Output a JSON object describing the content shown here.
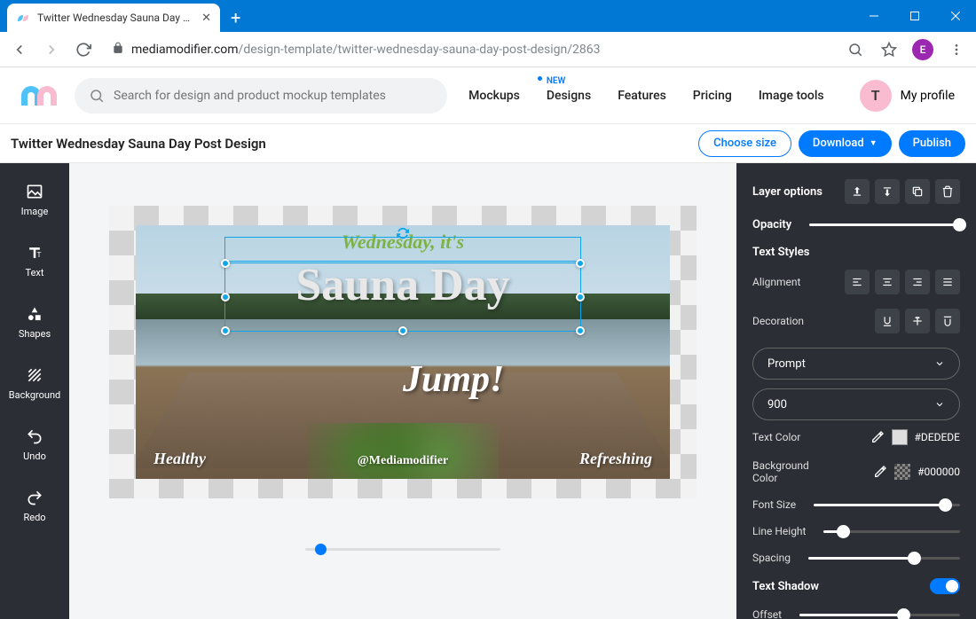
{
  "browser": {
    "tab_title": "Twitter Wednesday Sauna Day Po",
    "url_host": "mediamodifier.com",
    "url_path": "/design-template/twitter-wednesday-sauna-day-post-design/2863",
    "avatar_letter": "E"
  },
  "header": {
    "search_placeholder": "Search for design and product mockup templates",
    "nav": {
      "mockups": "Mockups",
      "designs": "Designs",
      "designs_badge": "NEW",
      "features": "Features",
      "pricing": "Pricing",
      "tools": "Image tools"
    },
    "profile_letter": "T",
    "profile_label": "My profile"
  },
  "titlebar": {
    "title": "Twitter Wednesday Sauna Day Post Design",
    "choose_size": "Choose size",
    "download": "Download",
    "publish": "Publish"
  },
  "left_tools": {
    "image": "Image",
    "text": "Text",
    "shapes": "Shapes",
    "background": "Background",
    "undo": "Undo",
    "redo": "Redo"
  },
  "canvas": {
    "text1": "Wednesday, it's",
    "text2": "Sauna Day",
    "text3": "Jump!",
    "text4": "Healthy",
    "text5": "@Mediamodifier",
    "text6": "Refreshing"
  },
  "right_panel": {
    "layer_options": "Layer options",
    "opacity": "Opacity",
    "opacity_value": 100,
    "text_styles": "Text Styles",
    "alignment": "Alignment",
    "decoration": "Decoration",
    "font_family": "Prompt",
    "font_weight": "900",
    "text_color_label": "Text Color",
    "text_color": "#DEDEDE",
    "bg_color_label": "Background Color",
    "bg_color": "#000000",
    "font_size_label": "Font Size",
    "font_size_pct": 90,
    "line_height_label": "Line Height",
    "line_height_pct": 15,
    "spacing_label": "Spacing",
    "spacing_pct": 70,
    "text_shadow_label": "Text Shadow",
    "offset_label": "Offset",
    "offset_pct": 65
  }
}
